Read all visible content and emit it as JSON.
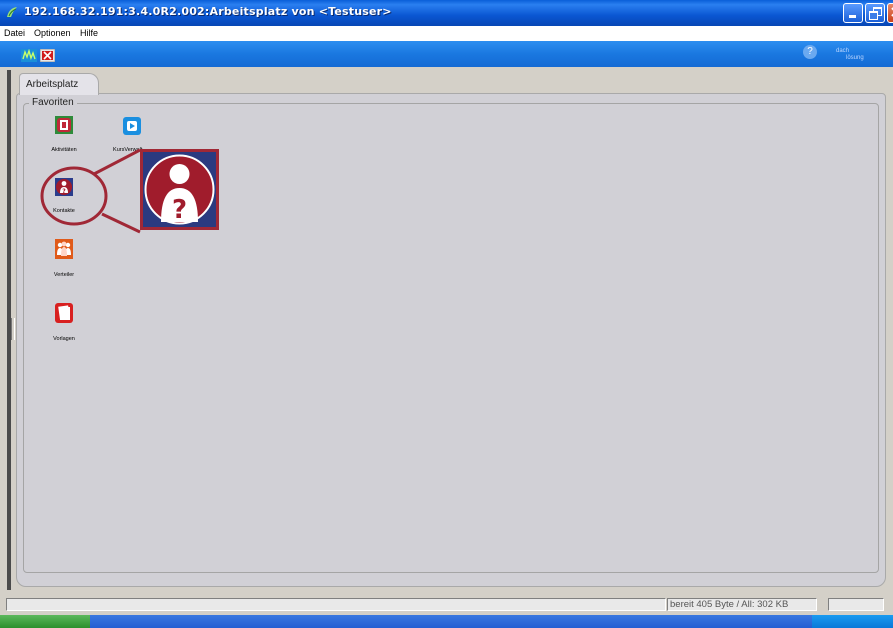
{
  "window": {
    "title": "192.168.32.191:3.4.0R2.002:Arbeitsplatz von <Testuser>"
  },
  "menu": {
    "items": [
      "Datei",
      "Optionen",
      "Hilfe"
    ]
  },
  "toolbar": {
    "help_glyph": "?",
    "logo_text_line1": "dach",
    "logo_text_line2": "lösung"
  },
  "tab": {
    "label": "Arbeitsplatz"
  },
  "favorites": {
    "group_label": "Favoriten",
    "items": [
      {
        "label": "Aktivitäten",
        "icon": "activities-icon",
        "color": "#2e8b3a"
      },
      {
        "label": "KursVerwalt...",
        "icon": "course-icon",
        "color": "#1a8fe0"
      },
      {
        "label": "Kontakte",
        "icon": "contact-icon",
        "color": "#a01c2c"
      },
      {
        "label": "Verteiler",
        "icon": "distribution-icon",
        "color": "#e05a1a"
      },
      {
        "label": "Vorlagen",
        "icon": "templates-icon",
        "color": "#d82020"
      }
    ],
    "zoomed_item": "contact-icon"
  },
  "status": {
    "memory_text": "bereit 405 Byte / All: 302 KB"
  },
  "colors": {
    "title_blue": "#0a56d2",
    "toolbar_blue": "#1a78e0",
    "highlight_red": "#a02836",
    "panel_gray": "#d1d0d6"
  }
}
